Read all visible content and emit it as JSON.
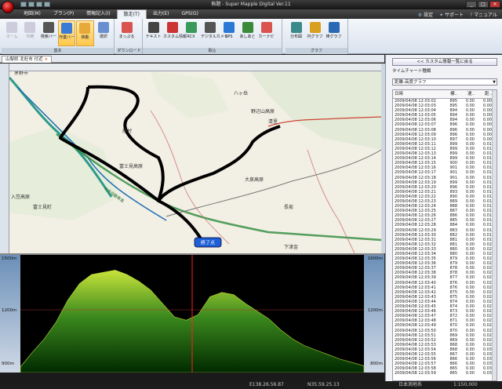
{
  "window": {
    "title": "無題 - Super Mapple Digital Ver.11"
  },
  "menu": {
    "tabs": [
      "地図(M)",
      "プラン(P)",
      "情報記入(I)",
      "散走(T)",
      "出力(E)",
      "GPS(G)"
    ],
    "active_index": 3
  },
  "helpers": {
    "settings": "設定",
    "support": "サポート",
    "manual": "マニュアル"
  },
  "ribbon": {
    "groups": [
      {
        "label": "基本",
        "buttons": [
          {
            "label": "ホーム",
            "disabled": true
          },
          {
            "label": "印刷",
            "disabled": true
          },
          {
            "label": "検索バー"
          },
          {
            "label": "作業バー",
            "selected": true
          },
          {
            "label": "移動",
            "selected": true
          },
          {
            "label": "選択"
          }
        ]
      },
      {
        "label": "ダウンロード",
        "buttons": [
          {
            "label": "まっぷる"
          }
        ]
      },
      {
        "label": "取込",
        "buttons": [
          {
            "label": "テキスト"
          },
          {
            "label": "カスタム情報"
          },
          {
            "label": "RCX"
          },
          {
            "label": "デジタルカメラ"
          },
          {
            "label": "GPS"
          },
          {
            "label": "あしあと"
          },
          {
            "label": "カーナビ"
          }
        ]
      },
      {
        "label": "グラフ",
        "buttons": [
          {
            "label": "分布図"
          },
          {
            "label": "円グラフ"
          },
          {
            "label": "棒グラフ"
          }
        ]
      }
    ]
  },
  "location_tab": {
    "label": "山梨県 北杜市 付近",
    "close": "×"
  },
  "map": {
    "places": [
      {
        "text": "茅野市"
      },
      {
        "text": "八ヶ岳"
      },
      {
        "text": "原村"
      },
      {
        "text": "野辺山高原"
      },
      {
        "text": "清里"
      },
      {
        "text": "富士見高原"
      },
      {
        "text": "大泉高原"
      },
      {
        "text": "富士見町"
      },
      {
        "text": "入笠高原"
      },
      {
        "text": "長坂"
      },
      {
        "text": "下津金"
      }
    ],
    "end_marker": "終了点",
    "road_labels": [
      "中央自動車道"
    ]
  },
  "elevation_chart": {
    "left_ticks": [
      "1500m",
      "1200m",
      "900m"
    ],
    "right_ticks": [
      "1600m",
      "1200m",
      "800m"
    ],
    "bottom_ticks": [
      "10.0km",
      "20.0km",
      "30.0km",
      "40.0km",
      "50.0km",
      "60.0km",
      "70.0km",
      "80.0km"
    ],
    "cursor_fraction": 0.5,
    "profile": [
      0.05,
      0.18,
      0.3,
      0.45,
      0.65,
      0.8,
      0.88,
      0.9,
      0.92,
      0.88,
      0.82,
      0.74,
      0.62,
      0.5,
      0.47,
      0.52,
      0.68,
      0.72,
      0.7,
      0.62,
      0.55,
      0.48,
      0.38,
      0.3,
      0.24,
      0.2,
      0.16,
      0.12,
      0.09,
      0.06
    ]
  },
  "statusbar": {
    "lon": "E138.26.56.87",
    "lat": "N35.59.25.13",
    "datum": "日本測地系",
    "scale": "1:150,000"
  },
  "right_panel": {
    "back_button": "<< カスタム情報一覧に戻る",
    "type_label": "タイムチャート種類",
    "select_value": "距離-高度グラフ",
    "columns": [
      "日時",
      "標..",
      "速..",
      "距.."
    ],
    "rows": [
      [
        "2009/04/08 12:03:02",
        "895",
        "0.00",
        "0.00"
      ],
      [
        "2009/04/08 12:03:03",
        "895",
        "0.00",
        "0.00"
      ],
      [
        "2009/04/08 12:03:04",
        "894",
        "0.00",
        "0.00"
      ],
      [
        "2009/04/08 12:03:05",
        "894",
        "0.00",
        "0.00"
      ],
      [
        "2009/04/08 12:03:06",
        "894",
        "0.00",
        "0.00"
      ],
      [
        "2009/04/08 12:03:07",
        "896",
        "0.00",
        "0.00"
      ],
      [
        "2009/04/08 12:03:08",
        "896",
        "0.00",
        "0.00"
      ],
      [
        "2009/04/08 12:03:09",
        "896",
        "0.00",
        "0.00"
      ],
      [
        "2009/04/08 12:03:10",
        "897",
        "0.00",
        "0.00"
      ],
      [
        "2009/04/08 12:03:11",
        "899",
        "0.00",
        "0.01"
      ],
      [
        "2009/04/08 12:03:12",
        "899",
        "0.00",
        "0.01"
      ],
      [
        "2009/04/08 12:03:13",
        "899",
        "0.00",
        "0.01"
      ],
      [
        "2009/04/08 12:03:14",
        "899",
        "0.00",
        "0.01"
      ],
      [
        "2009/04/08 12:03:15",
        "900",
        "0.00",
        "0.01"
      ],
      [
        "2009/04/08 12:03:16",
        "901",
        "0.00",
        "0.01"
      ],
      [
        "2009/04/08 12:03:17",
        "901",
        "0.00",
        "0.01"
      ],
      [
        "2009/04/08 12:03:18",
        "901",
        "0.00",
        "0.01"
      ],
      [
        "2009/04/08 12:03:19",
        "899",
        "0.00",
        "0.01"
      ],
      [
        "2009/04/08 12:03:20",
        "896",
        "0.00",
        "0.01"
      ],
      [
        "2009/04/08 12:03:21",
        "893",
        "0.00",
        "0.01"
      ],
      [
        "2009/04/08 12:03:22",
        "890",
        "0.00",
        "0.01"
      ],
      [
        "2009/04/08 12:03:23",
        "889",
        "0.00",
        "0.01"
      ],
      [
        "2009/04/08 12:03:24",
        "888",
        "0.00",
        "0.01"
      ],
      [
        "2009/04/08 12:03:25",
        "887",
        "0.00",
        "0.01"
      ],
      [
        "2009/04/08 12:03:26",
        "886",
        "0.00",
        "0.01"
      ],
      [
        "2009/04/08 12:03:27",
        "885",
        "0.00",
        "0.01"
      ],
      [
        "2009/04/08 12:03:28",
        "884",
        "0.00",
        "0.01"
      ],
      [
        "2009/04/08 12:03:29",
        "883",
        "0.00",
        "0.01"
      ],
      [
        "2009/04/08 12:03:30",
        "882",
        "0.00",
        "0.01"
      ],
      [
        "2009/04/08 12:03:31",
        "881",
        "0.00",
        "0.01"
      ],
      [
        "2009/04/08 12:03:32",
        "881",
        "0.00",
        "0.02"
      ],
      [
        "2009/04/08 12:03:33",
        "880",
        "0.00",
        "0.02"
      ],
      [
        "2009/04/08 12:03:34",
        "880",
        "0.00",
        "0.02"
      ],
      [
        "2009/04/08 12:03:35",
        "879",
        "0.00",
        "0.02"
      ],
      [
        "2009/04/08 12:03:36",
        "879",
        "0.00",
        "0.02"
      ],
      [
        "2009/04/08 12:03:37",
        "878",
        "0.00",
        "0.02"
      ],
      [
        "2009/04/08 12:03:38",
        "878",
        "0.00",
        "0.02"
      ],
      [
        "2009/04/08 12:03:39",
        "877",
        "0.00",
        "0.02"
      ],
      [
        "2009/04/08 12:03:40",
        "876",
        "0.00",
        "0.02"
      ],
      [
        "2009/04/08 12:03:41",
        "876",
        "0.00",
        "0.02"
      ],
      [
        "2009/04/08 12:03:42",
        "875",
        "0.00",
        "0.02"
      ],
      [
        "2009/04/08 12:03:43",
        "875",
        "0.00",
        "0.02"
      ],
      [
        "2009/04/08 12:03:44",
        "874",
        "0.00",
        "0.02"
      ],
      [
        "2009/04/08 12:03:45",
        "874",
        "0.00",
        "0.02"
      ],
      [
        "2009/04/08 12:03:46",
        "873",
        "0.00",
        "0.02"
      ],
      [
        "2009/04/08 12:03:47",
        "872",
        "0.00",
        "0.02"
      ],
      [
        "2009/04/08 12:03:48",
        "871",
        "0.00",
        "0.02"
      ],
      [
        "2009/04/08 12:03:49",
        "870",
        "0.00",
        "0.02"
      ],
      [
        "2009/04/08 12:03:50",
        "870",
        "0.00",
        "0.02"
      ],
      [
        "2009/04/08 12:03:51",
        "869",
        "0.00",
        "0.02"
      ],
      [
        "2009/04/08 12:03:52",
        "869",
        "0.00",
        "0.02"
      ],
      [
        "2009/04/08 12:03:53",
        "868",
        "0.00",
        "0.02"
      ],
      [
        "2009/04/08 12:03:54",
        "868",
        "0.00",
        "0.03"
      ],
      [
        "2009/04/08 12:03:55",
        "867",
        "0.00",
        "0.03"
      ],
      [
        "2009/04/08 12:03:56",
        "866",
        "0.00",
        "0.03"
      ],
      [
        "2009/04/08 12:03:57",
        "866",
        "0.00",
        "0.03"
      ],
      [
        "2009/04/08 12:03:58",
        "865",
        "0.00",
        "0.03"
      ],
      [
        "2009/04/08 12:03:59",
        "865",
        "0.00",
        "0.03"
      ]
    ]
  },
  "colors": {
    "accent": "#ffc74a",
    "track": "#000000",
    "cursor": "#ff2020",
    "profile_top": "#c8e43a",
    "profile_bottom": "#002a00"
  }
}
